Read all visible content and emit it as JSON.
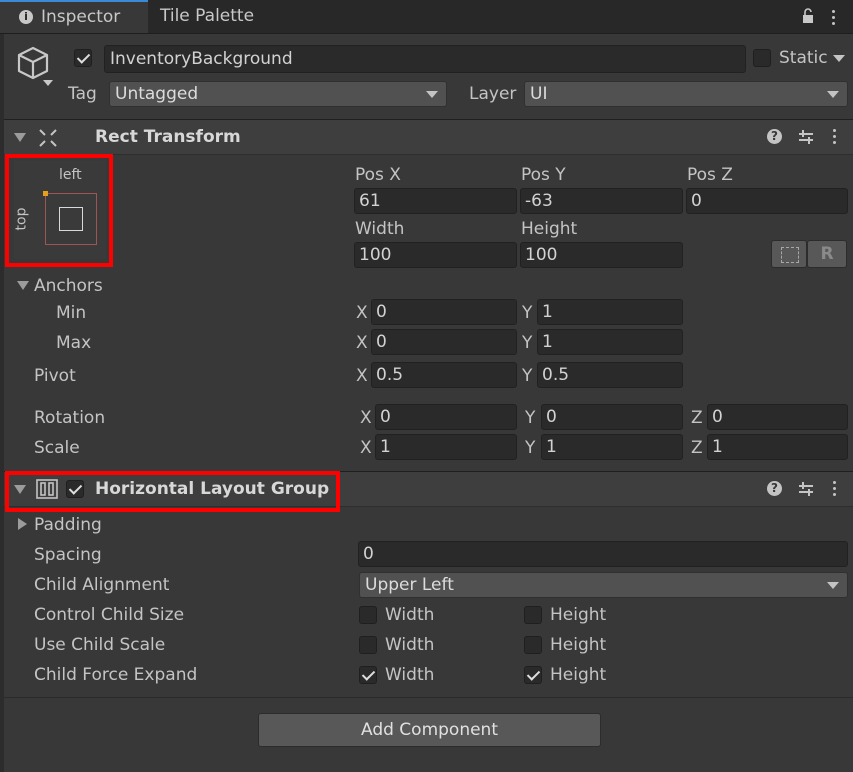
{
  "tabs": {
    "inspector": "Inspector",
    "tile_palette": "Tile Palette"
  },
  "gameobject": {
    "name": "InventoryBackground",
    "static_label": "Static",
    "tag_label": "Tag",
    "tag_value": "Untagged",
    "layer_label": "Layer",
    "layer_value": "UI"
  },
  "rect_transform": {
    "title": "Rect Transform",
    "anchor_preset": {
      "top_label": "left",
      "side_label": "top"
    },
    "pos_x_label": "Pos X",
    "pos_x": "61",
    "pos_y_label": "Pos Y",
    "pos_y": "-63",
    "pos_z_label": "Pos Z",
    "pos_z": "0",
    "width_label": "Width",
    "width": "100",
    "height_label": "Height",
    "height": "100",
    "raw_button": "R",
    "anchors_label": "Anchors",
    "min_label": "Min",
    "min_x": "0",
    "min_y": "1",
    "max_label": "Max",
    "max_x": "0",
    "max_y": "1",
    "pivot_label": "Pivot",
    "pivot_x": "0.5",
    "pivot_y": "0.5",
    "rotation_label": "Rotation",
    "rot_x": "0",
    "rot_y": "0",
    "rot_z": "0",
    "scale_label": "Scale",
    "scale_x": "1",
    "scale_y": "1",
    "scale_z": "1",
    "x": "X",
    "y": "Y",
    "z": "Z"
  },
  "layout_group": {
    "title": "Horizontal Layout Group",
    "enabled": true,
    "padding_label": "Padding",
    "spacing_label": "Spacing",
    "spacing": "0",
    "alignment_label": "Child Alignment",
    "alignment": "Upper Left",
    "control_size_label": "Control Child Size",
    "use_scale_label": "Use Child Scale",
    "force_expand_label": "Child Force Expand",
    "width_label": "Width",
    "height_label": "Height",
    "control_size": {
      "width": false,
      "height": false
    },
    "use_scale": {
      "width": false,
      "height": false
    },
    "force_expand": {
      "width": true,
      "height": true
    }
  },
  "add_component": "Add Component",
  "colors": {
    "highlight": "#ff0000",
    "accent": "#3c89d8",
    "background": "#383838"
  }
}
